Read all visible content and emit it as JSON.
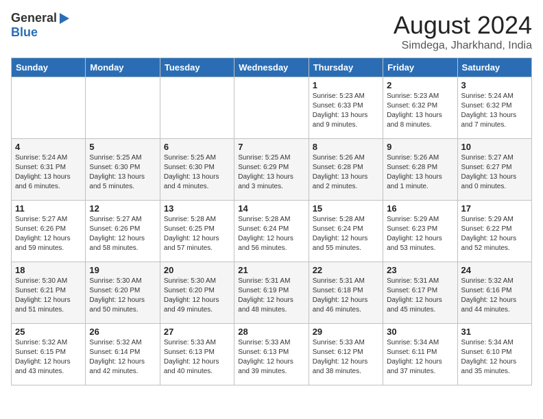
{
  "header": {
    "logo_general": "General",
    "logo_blue": "Blue",
    "month_year": "August 2024",
    "location": "Simdega, Jharkhand, India"
  },
  "days_of_week": [
    "Sunday",
    "Monday",
    "Tuesday",
    "Wednesday",
    "Thursday",
    "Friday",
    "Saturday"
  ],
  "weeks": [
    [
      {
        "day": "",
        "text": ""
      },
      {
        "day": "",
        "text": ""
      },
      {
        "day": "",
        "text": ""
      },
      {
        "day": "",
        "text": ""
      },
      {
        "day": "1",
        "text": "Sunrise: 5:23 AM\nSunset: 6:33 PM\nDaylight: 13 hours\nand 9 minutes."
      },
      {
        "day": "2",
        "text": "Sunrise: 5:23 AM\nSunset: 6:32 PM\nDaylight: 13 hours\nand 8 minutes."
      },
      {
        "day": "3",
        "text": "Sunrise: 5:24 AM\nSunset: 6:32 PM\nDaylight: 13 hours\nand 7 minutes."
      }
    ],
    [
      {
        "day": "4",
        "text": "Sunrise: 5:24 AM\nSunset: 6:31 PM\nDaylight: 13 hours\nand 6 minutes."
      },
      {
        "day": "5",
        "text": "Sunrise: 5:25 AM\nSunset: 6:30 PM\nDaylight: 13 hours\nand 5 minutes."
      },
      {
        "day": "6",
        "text": "Sunrise: 5:25 AM\nSunset: 6:30 PM\nDaylight: 13 hours\nand 4 minutes."
      },
      {
        "day": "7",
        "text": "Sunrise: 5:25 AM\nSunset: 6:29 PM\nDaylight: 13 hours\nand 3 minutes."
      },
      {
        "day": "8",
        "text": "Sunrise: 5:26 AM\nSunset: 6:28 PM\nDaylight: 13 hours\nand 2 minutes."
      },
      {
        "day": "9",
        "text": "Sunrise: 5:26 AM\nSunset: 6:28 PM\nDaylight: 13 hours\nand 1 minute."
      },
      {
        "day": "10",
        "text": "Sunrise: 5:27 AM\nSunset: 6:27 PM\nDaylight: 13 hours\nand 0 minutes."
      }
    ],
    [
      {
        "day": "11",
        "text": "Sunrise: 5:27 AM\nSunset: 6:26 PM\nDaylight: 12 hours\nand 59 minutes."
      },
      {
        "day": "12",
        "text": "Sunrise: 5:27 AM\nSunset: 6:26 PM\nDaylight: 12 hours\nand 58 minutes."
      },
      {
        "day": "13",
        "text": "Sunrise: 5:28 AM\nSunset: 6:25 PM\nDaylight: 12 hours\nand 57 minutes."
      },
      {
        "day": "14",
        "text": "Sunrise: 5:28 AM\nSunset: 6:24 PM\nDaylight: 12 hours\nand 56 minutes."
      },
      {
        "day": "15",
        "text": "Sunrise: 5:28 AM\nSunset: 6:24 PM\nDaylight: 12 hours\nand 55 minutes."
      },
      {
        "day": "16",
        "text": "Sunrise: 5:29 AM\nSunset: 6:23 PM\nDaylight: 12 hours\nand 53 minutes."
      },
      {
        "day": "17",
        "text": "Sunrise: 5:29 AM\nSunset: 6:22 PM\nDaylight: 12 hours\nand 52 minutes."
      }
    ],
    [
      {
        "day": "18",
        "text": "Sunrise: 5:30 AM\nSunset: 6:21 PM\nDaylight: 12 hours\nand 51 minutes."
      },
      {
        "day": "19",
        "text": "Sunrise: 5:30 AM\nSunset: 6:20 PM\nDaylight: 12 hours\nand 50 minutes."
      },
      {
        "day": "20",
        "text": "Sunrise: 5:30 AM\nSunset: 6:20 PM\nDaylight: 12 hours\nand 49 minutes."
      },
      {
        "day": "21",
        "text": "Sunrise: 5:31 AM\nSunset: 6:19 PM\nDaylight: 12 hours\nand 48 minutes."
      },
      {
        "day": "22",
        "text": "Sunrise: 5:31 AM\nSunset: 6:18 PM\nDaylight: 12 hours\nand 46 minutes."
      },
      {
        "day": "23",
        "text": "Sunrise: 5:31 AM\nSunset: 6:17 PM\nDaylight: 12 hours\nand 45 minutes."
      },
      {
        "day": "24",
        "text": "Sunrise: 5:32 AM\nSunset: 6:16 PM\nDaylight: 12 hours\nand 44 minutes."
      }
    ],
    [
      {
        "day": "25",
        "text": "Sunrise: 5:32 AM\nSunset: 6:15 PM\nDaylight: 12 hours\nand 43 minutes."
      },
      {
        "day": "26",
        "text": "Sunrise: 5:32 AM\nSunset: 6:14 PM\nDaylight: 12 hours\nand 42 minutes."
      },
      {
        "day": "27",
        "text": "Sunrise: 5:33 AM\nSunset: 6:13 PM\nDaylight: 12 hours\nand 40 minutes."
      },
      {
        "day": "28",
        "text": "Sunrise: 5:33 AM\nSunset: 6:13 PM\nDaylight: 12 hours\nand 39 minutes."
      },
      {
        "day": "29",
        "text": "Sunrise: 5:33 AM\nSunset: 6:12 PM\nDaylight: 12 hours\nand 38 minutes."
      },
      {
        "day": "30",
        "text": "Sunrise: 5:34 AM\nSunset: 6:11 PM\nDaylight: 12 hours\nand 37 minutes."
      },
      {
        "day": "31",
        "text": "Sunrise: 5:34 AM\nSunset: 6:10 PM\nDaylight: 12 hours\nand 35 minutes."
      }
    ]
  ]
}
